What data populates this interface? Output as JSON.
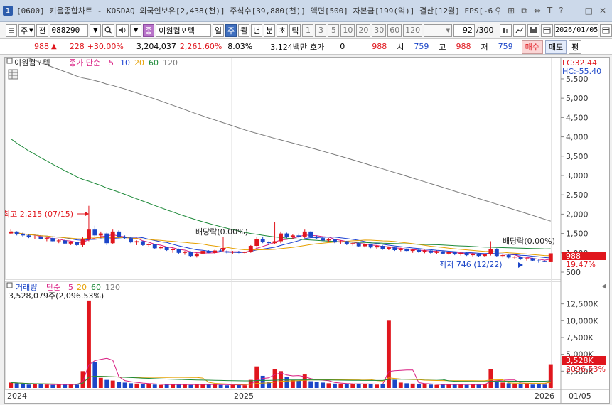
{
  "window": {
    "screen_no": "1",
    "title": "[0600] 키움종합차트 - KOSDAQ 외국인보유[2,438(천)] 주식수[39,880(천)] 액면[500] 자본금[199(억)] 결산[12월] EPS[-6",
    "controls": [
      "♀",
      "⊞",
      "⧉",
      "⇔",
      "T",
      "?",
      "—",
      "□",
      "✕"
    ]
  },
  "toolbar": {
    "period_label": "주",
    "all_label": "전",
    "code": "088290",
    "stock_name": "이원컴포텍",
    "name_badge": "종",
    "periods": [
      "일",
      "주",
      "월",
      "년",
      "분",
      "초",
      "틱"
    ],
    "selected_period": "주",
    "intervals": [
      "1",
      "3",
      "5",
      "10",
      "20",
      "30",
      "60",
      "120"
    ],
    "count": "92",
    "count_total": "/300",
    "date": "2026/01/05"
  },
  "quote": {
    "price": "988",
    "change": "228",
    "change_pct": "+30.00%",
    "volume": "3,204,037",
    "volume_ratio": "2,261.60%",
    "turnover": "8.03%",
    "amount": "3,124백만",
    "ask_label": "호가",
    "ask_value": "0",
    "ask_price": "988",
    "open_label": "시",
    "open": "759",
    "high_label": "고",
    "high": "988",
    "low_label": "저",
    "low": "759",
    "buy_label": "매수",
    "sell_label": "매도",
    "eval_label": "평"
  },
  "price_pane": {
    "name_tag": "이원컴포텍",
    "legend_prefix": "종가 단순",
    "ma_periods": [
      "5",
      "10",
      "20",
      "60",
      "120"
    ],
    "lc": "LC:32.44",
    "hc": "HC:-55.40",
    "high_annotation": "최고 2,215 (07/15)",
    "low_annotation": "최저 746 (12/22)",
    "dividend_label_1": "배당락(0.00%)",
    "dividend_label_2": "배당락(0.00%)",
    "current_price_tag": "988",
    "current_pct_tag": "19.47%"
  },
  "volume_pane": {
    "title": "거래량",
    "legend_prefix": "단순",
    "ma_periods": [
      "5",
      "20",
      "60",
      "120"
    ],
    "current_value": "3,528,079주(2,096.53%)",
    "current_tag": "3,528K",
    "current_pct_tag": "2096.53%"
  },
  "x_axis": {
    "labels": [
      "2024",
      "2025",
      "2026"
    ],
    "right_label": "01/05"
  },
  "colors": {
    "up": "#e0161d",
    "down": "#1c46c8",
    "ma5": "#d81b80",
    "ma10": "#1a3fd1",
    "ma20": "#e6a000",
    "ma60": "#1e8a3a",
    "ma120": "#7a7a7a"
  },
  "chart_data": [
    {
      "type": "candlestick",
      "title": "이원컴포텍 주봉",
      "y_ticks": [
        500,
        1000,
        1500,
        2000,
        2500,
        3000,
        3500,
        4000,
        4500,
        5000,
        5500
      ],
      "y_tick_labels": [
        "500",
        "1,000",
        "1,500",
        "2,000",
        "2,500",
        "3,000",
        "3,500",
        "4,000",
        "4,500",
        "5,000",
        "5,500"
      ],
      "ylim": [
        390,
        5830
      ],
      "x_range": [
        "2024-01",
        "2026-01"
      ],
      "annotations": {
        "high": {
          "value": 2215,
          "date": "07/15"
        },
        "low": {
          "value": 746,
          "date": "12/22"
        }
      },
      "candles": [
        [
          1500,
          1600,
          1480,
          1550
        ],
        [
          1550,
          1560,
          1450,
          1480
        ],
        [
          1480,
          1520,
          1420,
          1450
        ],
        [
          1450,
          1470,
          1380,
          1400
        ],
        [
          1400,
          1450,
          1360,
          1420
        ],
        [
          1420,
          1460,
          1340,
          1350
        ],
        [
          1350,
          1400,
          1300,
          1380
        ],
        [
          1380,
          1400,
          1280,
          1300
        ],
        [
          1300,
          1360,
          1250,
          1320
        ],
        [
          1320,
          1340,
          1220,
          1240
        ],
        [
          1240,
          1300,
          1200,
          1280
        ],
        [
          1280,
          1290,
          1180,
          1200
        ],
        [
          1200,
          1400,
          1150,
          1350
        ],
        [
          1350,
          2215,
          1300,
          1600
        ],
        [
          1600,
          1700,
          1400,
          1450
        ],
        [
          1450,
          1550,
          1380,
          1500
        ],
        [
          1500,
          1520,
          1200,
          1250
        ],
        [
          1250,
          1600,
          1220,
          1550
        ],
        [
          1550,
          1580,
          1380,
          1400
        ],
        [
          1400,
          1450,
          1350,
          1380
        ],
        [
          1380,
          1400,
          1250,
          1270
        ],
        [
          1270,
          1320,
          1200,
          1300
        ],
        [
          1300,
          1310,
          1180,
          1200
        ],
        [
          1200,
          1250,
          1150,
          1220
        ],
        [
          1220,
          1230,
          1100,
          1120
        ],
        [
          1120,
          1180,
          1080,
          1150
        ],
        [
          1150,
          1160,
          1050,
          1070
        ],
        [
          1070,
          1120,
          1000,
          1100
        ],
        [
          1100,
          1110,
          980,
          1000
        ],
        [
          1000,
          1050,
          950,
          1030
        ],
        [
          1030,
          1040,
          900,
          920
        ],
        [
          920,
          1000,
          880,
          980
        ],
        [
          980,
          1060,
          960,
          1050
        ],
        [
          1050,
          1070,
          990,
          1000
        ],
        [
          1000,
          1080,
          980,
          1060
        ],
        [
          1060,
          1100,
          1020,
          1040
        ],
        [
          1040,
          1060,
          990,
          1010
        ],
        [
          1010,
          1050,
          980,
          1030
        ],
        [
          1030,
          1050,
          990,
          1000
        ],
        [
          1000,
          1040,
          960,
          1020
        ],
        [
          1020,
          1200,
          1000,
          1180
        ],
        [
          1180,
          1400,
          1100,
          1350
        ],
        [
          1350,
          1420,
          1250,
          1280
        ],
        [
          1280,
          1300,
          1200,
          1250
        ],
        [
          1250,
          1800,
          1220,
          1300
        ],
        [
          1300,
          1550,
          1250,
          1500
        ],
        [
          1500,
          1520,
          1380,
          1400
        ],
        [
          1400,
          1480,
          1350,
          1450
        ],
        [
          1450,
          1500,
          1380,
          1420
        ],
        [
          1420,
          1600,
          1380,
          1550
        ],
        [
          1550,
          1560,
          1400,
          1420
        ],
        [
          1420,
          1450,
          1350,
          1380
        ],
        [
          1380,
          1420,
          1300,
          1320
        ],
        [
          1320,
          1380,
          1280,
          1350
        ],
        [
          1350,
          1360,
          1250,
          1270
        ],
        [
          1270,
          1320,
          1230,
          1300
        ],
        [
          1300,
          1310,
          1200,
          1220
        ],
        [
          1220,
          1280,
          1190,
          1250
        ],
        [
          1250,
          1260,
          1150,
          1170
        ],
        [
          1170,
          1240,
          1140,
          1220
        ],
        [
          1220,
          1230,
          1120,
          1140
        ],
        [
          1140,
          1200,
          1100,
          1180
        ],
        [
          1180,
          1190,
          1080,
          1100
        ],
        [
          1100,
          1160,
          1070,
          1140
        ],
        [
          1140,
          1150,
          1050,
          1070
        ],
        [
          1070,
          1130,
          1040,
          1110
        ],
        [
          1110,
          1120,
          1030,
          1050
        ],
        [
          1050,
          1100,
          1000,
          1080
        ],
        [
          1080,
          1090,
          1000,
          1020
        ],
        [
          1020,
          1080,
          990,
          1060
        ],
        [
          1060,
          1070,
          980,
          1000
        ],
        [
          1000,
          1060,
          970,
          1040
        ],
        [
          1040,
          1050,
          960,
          980
        ],
        [
          980,
          1040,
          950,
          1020
        ],
        [
          1020,
          1030,
          940,
          960
        ],
        [
          960,
          1020,
          930,
          1000
        ],
        [
          1000,
          1010,
          920,
          940
        ],
        [
          940,
          1000,
          910,
          980
        ],
        [
          980,
          990,
          900,
          920
        ],
        [
          920,
          980,
          890,
          960
        ],
        [
          960,
          1300,
          930,
          1100
        ],
        [
          1100,
          1120,
          900,
          920
        ],
        [
          920,
          960,
          880,
          940
        ],
        [
          940,
          950,
          860,
          880
        ],
        [
          880,
          920,
          850,
          900
        ],
        [
          900,
          910,
          820,
          840
        ],
        [
          840,
          880,
          800,
          860
        ],
        [
          860,
          870,
          780,
          800
        ],
        [
          800,
          830,
          746,
          780
        ],
        [
          780,
          800,
          760,
          770
        ],
        [
          759,
          988,
          759,
          988
        ]
      ],
      "volume": {
        "y_ticks": [
          2500000,
          5000000,
          7500000,
          10000000,
          12500000
        ],
        "y_tick_labels": [
          "2,500K",
          "5,000K",
          "7,500K",
          "10,000K",
          "12,500K"
        ],
        "ylim": [
          0,
          13200000
        ],
        "values": [
          800000,
          700000,
          600000,
          500000,
          550000,
          600000,
          500000,
          450000,
          500000,
          600000,
          550000,
          500000,
          2500000,
          13000000,
          3800000,
          1500000,
          1200000,
          1100000,
          900000,
          800000,
          700000,
          650000,
          600000,
          550000,
          500000,
          450000,
          500000,
          550000,
          600000,
          500000,
          450000,
          500000,
          600000,
          550000,
          500000,
          450000,
          400000,
          450000,
          500000,
          400000,
          1200000,
          3200000,
          1800000,
          900000,
          2800000,
          2500000,
          1600000,
          1200000,
          1100000,
          2000000,
          1000000,
          900000,
          800000,
          700000,
          650000,
          600000,
          550000,
          600000,
          650000,
          600000,
          550000,
          500000,
          600000,
          10000000,
          1200000,
          800000,
          700000,
          650000,
          600000,
          550000,
          500000,
          450000,
          500000,
          550000,
          600000,
          500000,
          450000,
          500000,
          550000,
          600000,
          2800000,
          1000000,
          800000,
          700000,
          650000,
          600000,
          550000,
          500000,
          600000,
          500000,
          3528079
        ]
      }
    }
  ]
}
